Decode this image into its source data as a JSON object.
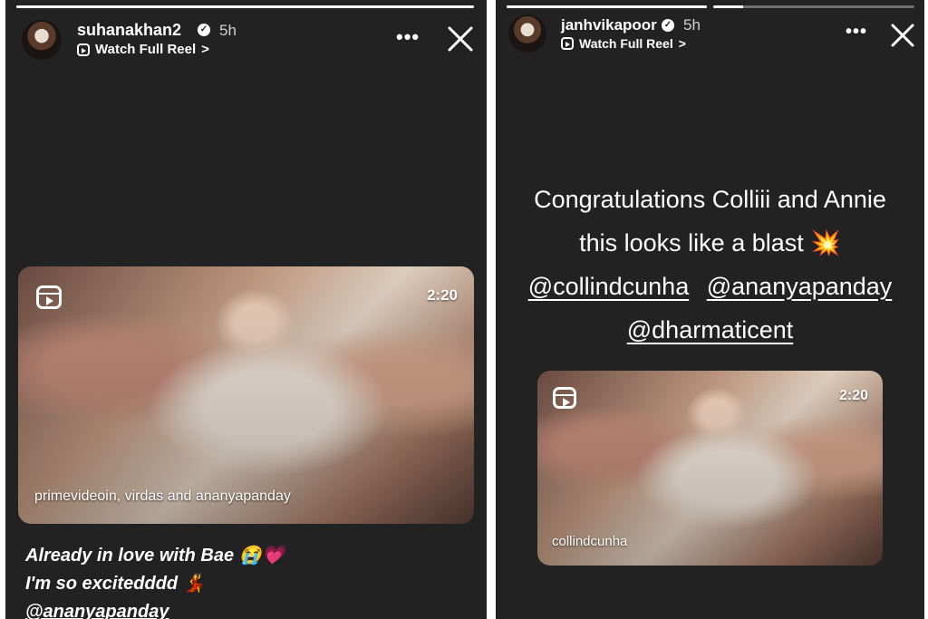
{
  "left_story": {
    "username": "suhanakhan2",
    "verified_badge": "verified-icon",
    "time": "5h",
    "watch_reel_label": "Watch Full Reel",
    "watch_reel_chevron": ">",
    "more_label": "•••",
    "progress_fraction": 1.0,
    "video": {
      "duration": "2:20",
      "caption": "primevideoin, virdas and ananyapanday"
    },
    "text_lines": [
      "Already in love with Bae 😭💗",
      "I'm so excitedddd 💃"
    ],
    "mention": "@ananyapanday"
  },
  "right_story": {
    "username": "janhvikapoor",
    "verified_badge": "verified-icon",
    "time": "5h",
    "watch_reel_label": "Watch Full Reel",
    "watch_reel_chevron": ">",
    "more_label": "•••",
    "progress_fraction": 0.15,
    "text_line1": "Congratulations Colliii and Annie",
    "text_line2": "this looks like a blast 💥",
    "mentions": [
      "@collindcunha",
      "@ananyapanday",
      "@dharmaticent"
    ],
    "video": {
      "duration": "2:20",
      "caption": "collindcunha"
    }
  }
}
